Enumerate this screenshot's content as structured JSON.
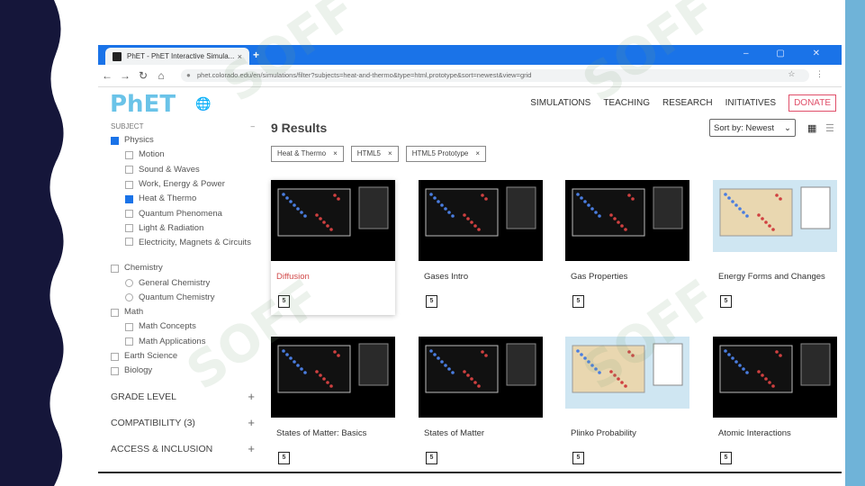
{
  "browser": {
    "tab_title": "PhET - PhET Interactive Simula...",
    "tab_close": "×",
    "new_tab": "+",
    "window_controls": "–  ▢  ✕",
    "url": "phet.colorado.edu/en/simulations/filter?subjects=heat-and-thermo&type=html,prototype&sort=newest&view=grid",
    "nav": {
      "back": "←",
      "forward": "→",
      "reload": "↻",
      "home": "⌂"
    }
  },
  "site": {
    "logo_main": "PhET",
    "nav": [
      "SIMULATIONS",
      "TEACHING",
      "RESEARCH",
      "INITIATIVES"
    ],
    "donate": "DONATE"
  },
  "sidebar": {
    "subject_header": "SUBJECT",
    "subject_toggle": "–",
    "items": [
      {
        "label": "Physics",
        "level": 0,
        "checked": true
      },
      {
        "label": "Motion",
        "level": 1,
        "checked": false
      },
      {
        "label": "Sound & Waves",
        "level": 1,
        "checked": false
      },
      {
        "label": "Work, Energy & Power",
        "level": 1,
        "checked": false
      },
      {
        "label": "Heat & Thermo",
        "level": 1,
        "checked": true
      },
      {
        "label": "Quantum Phenomena",
        "level": 1,
        "checked": false
      },
      {
        "label": "Light & Radiation",
        "level": 1,
        "checked": false
      },
      {
        "label": "Electricity, Magnets & Circuits",
        "level": 1,
        "checked": false
      },
      {
        "label": "Chemistry",
        "level": 0,
        "checked": false
      },
      {
        "label": "General Chemistry",
        "level": 1,
        "checked": false
      },
      {
        "label": "Quantum Chemistry",
        "level": 1,
        "checked": false
      },
      {
        "label": "Math",
        "level": 0,
        "checked": false
      },
      {
        "label": "Math Concepts",
        "level": 1,
        "checked": false
      },
      {
        "label": "Math Applications",
        "level": 1,
        "checked": false
      },
      {
        "label": "Earth Science",
        "level": 0,
        "checked": false
      },
      {
        "label": "Biology",
        "level": 0,
        "checked": false
      }
    ],
    "sections": [
      {
        "label": "GRADE LEVEL",
        "toggle": "+"
      },
      {
        "label": "COMPATIBILITY (3)",
        "toggle": "+"
      },
      {
        "label": "ACCESS & INCLUSION",
        "toggle": "+"
      }
    ]
  },
  "results": {
    "title": "9 Results",
    "sort_label": "Sort by: Newest",
    "filters": [
      "Heat & Thermo",
      "HTML5",
      "HTML5 Prototype"
    ],
    "filter_remove": "×",
    "cards": [
      {
        "title": "Diffusion",
        "theme": "dark",
        "selected": true
      },
      {
        "title": "Gases Intro",
        "theme": "dark",
        "selected": false
      },
      {
        "title": "Gas Properties",
        "theme": "dark",
        "selected": false
      },
      {
        "title": "Energy Forms and Changes",
        "theme": "light",
        "selected": false
      },
      {
        "title": "States of Matter: Basics",
        "theme": "dark",
        "selected": false
      },
      {
        "title": "States of Matter",
        "theme": "dark",
        "selected": false
      },
      {
        "title": "Plinko Probability",
        "theme": "light",
        "selected": false
      },
      {
        "title": "Atomic Interactions",
        "theme": "dark",
        "selected": false
      }
    ],
    "html5_badge": "5"
  },
  "colors": {
    "tab_strip": "#1a73e8",
    "accent_blue": "#6fb3d8",
    "slide_dark": "#15163a",
    "donate": "#e0506a"
  },
  "watermark": "SOFF"
}
